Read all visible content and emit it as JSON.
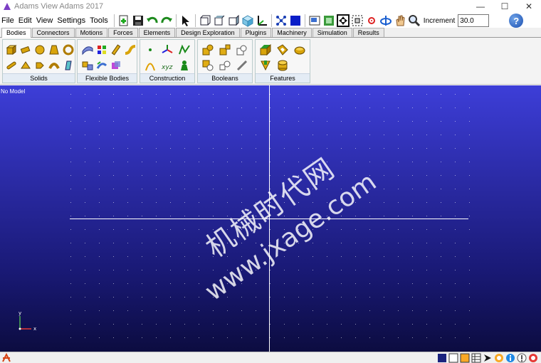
{
  "window": {
    "title": "Adams View Adams 2017",
    "minimize_glyph": "—",
    "maximize_glyph": "☐",
    "close_glyph": "✕"
  },
  "menu": {
    "items": [
      "File",
      "Edit",
      "View",
      "Settings",
      "Tools"
    ]
  },
  "toolbar": {
    "increment_label": "Increment",
    "increment_value": "30.0",
    "help_glyph": "?",
    "icons": [
      "new-model-icon",
      "save-icon",
      "undo-icon",
      "redo-icon",
      "select-arrow-icon",
      "view-front-icon",
      "view-top-icon",
      "view-side-icon",
      "view-iso-icon",
      "axes-icon",
      "explode-icon",
      "render-mode-icon",
      "layer-icon",
      "fit-view-icon",
      "zoom-fit-icon",
      "zoom-box-icon",
      "center-icon",
      "rotate-icon",
      "pan-hand-icon",
      "zoom-icon"
    ]
  },
  "tabs": {
    "active": "Bodies",
    "items": [
      "Bodies",
      "Connectors",
      "Motions",
      "Forces",
      "Elements",
      "Design Exploration",
      "Plugins",
      "Machinery",
      "Simulation",
      "Results"
    ]
  },
  "ribbon": {
    "groups": [
      {
        "label": "Solids",
        "icons": [
          "box-icon",
          "cylinder-icon",
          "sphere-icon",
          "frustum-icon",
          "torus-icon",
          "link-icon",
          "plate-icon",
          "extrusion-icon",
          "revolution-icon",
          "plane-icon"
        ]
      },
      {
        "label": "Flexible Bodies",
        "icons": [
          "flex-body-icon",
          "viewflex-icon",
          "flex-beam-icon",
          "flex-link-icon",
          "swap-flex-icon",
          "discrete-flex-icon",
          "flex-edit-icon"
        ]
      },
      {
        "label": "Construction",
        "icons": [
          "point-icon",
          "marker-icon",
          "polyline-icon",
          "arc-icon",
          "coordinate-xyz-icon",
          "mass-icon"
        ]
      },
      {
        "label": "Booleans",
        "icons": [
          "union-icon",
          "merge-icon",
          "intersect-icon",
          "cut-icon",
          "split-icon",
          "chain-icon"
        ]
      },
      {
        "label": "Features",
        "icons": [
          "chamfer-icon",
          "hollow-icon",
          "fillet-icon",
          "hole-icon",
          "boss-icon"
        ]
      }
    ]
  },
  "viewport": {
    "status_text": "No Model",
    "triad_x": "x",
    "triad_y": "y",
    "watermark_line1": "机械时代网",
    "watermark_line2": "www.jxage.com",
    "background_top": "#3d3ed8",
    "background_bottom": "#0c0c40"
  },
  "statusbar": {
    "icons": [
      "command-window-icon",
      "selection-icon",
      "info-icon",
      "table-icon",
      "arrow-icon",
      "plugin-icon",
      "status-info-icon",
      "interrupt-icon",
      "stop-icon"
    ]
  }
}
